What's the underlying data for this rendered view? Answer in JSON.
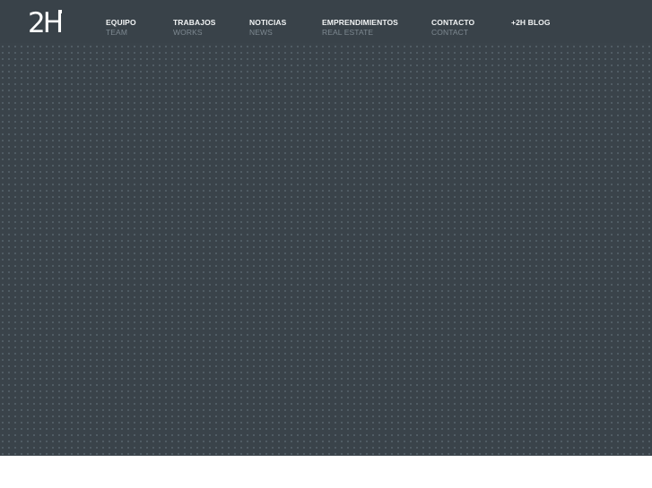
{
  "logo": {
    "text": "2H"
  },
  "nav": {
    "items": [
      {
        "main": "EQUIPO",
        "sub": "TEAM"
      },
      {
        "main": "TRABAJOS",
        "sub": "WORKS"
      },
      {
        "main": "NOTICIAS",
        "sub": "NEWS"
      },
      {
        "main": "EMPRENDIMIENTOS",
        "sub": "REAL ESTATE"
      },
      {
        "main": "CONTACTO",
        "sub": "CONTACT"
      },
      {
        "main": "+2H BLOG",
        "sub": ""
      }
    ]
  },
  "colors": {
    "background": "#3a434a",
    "nav_main": "#f2f4f5",
    "nav_sub": "#7d8890"
  }
}
